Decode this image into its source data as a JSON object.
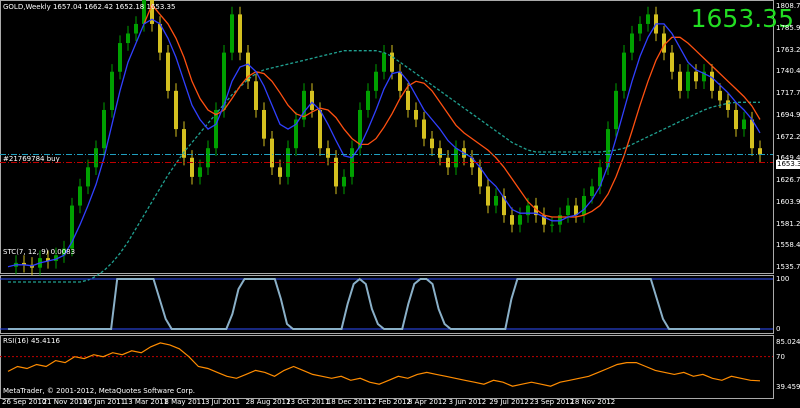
{
  "header": {
    "title": "GOLD,Weekly  1657.04 1662.42 1652.18 1653.35",
    "big_price": "1653.35",
    "order_label": "#21769784 buy",
    "order_price": "1653.35",
    "copyright": "MetaTrader, © 2001-2012, MetaQuotes Software Corp."
  },
  "stc": {
    "label": "STC(7, 12, 9) 0.0083",
    "levels": [
      "100",
      "0"
    ]
  },
  "rsi": {
    "label": "RSI(16) 45.4116",
    "levels": [
      "85.0241",
      "70",
      "39.4598"
    ]
  },
  "price_axis": [
    "1808.77",
    "1785.96",
    "1763.21",
    "1740.46",
    "1717.71",
    "1694.96",
    "1672.21",
    "1649.46",
    "1626.71",
    "1603.96",
    "1581.21",
    "1558.46",
    "1535.71"
  ],
  "time_axis": [
    "26 Sep 2010",
    "21 Nov 2010",
    "16 Jan 2011",
    "13 Mar 2011",
    "8 May 2011",
    "3 Jul 2011",
    "28 Aug 2011",
    "23 Oct 2011",
    "18 Dec 2011",
    "12 Feb 2012",
    "8 Apr 2012",
    "3 Jun 2012",
    "29 Jul 2012",
    "23 Sep 2012",
    "18 Nov 2012"
  ],
  "colors": {
    "background": "#000000",
    "bull_candle": "#00a000",
    "bear_candle": "#d4c020",
    "fast_ma": "#3040ff",
    "slow_ma": "#ff5010",
    "dotted_ma": "#20a090",
    "stc_line": "#8ab0c8",
    "rsi_line": "#ff8c00",
    "big_price": "#22dd22",
    "order_line": "#20a0c0",
    "stop_line": "#c00000"
  },
  "chart_data": [
    {
      "type": "candlestick",
      "title": "GOLD,Weekly",
      "ylim": [
        1535.71,
        1808.77
      ],
      "x_ticks": [
        "26 Sep 2010",
        "21 Nov 2010",
        "16 Jan 2011",
        "13 Mar 2011",
        "8 May 2011",
        "3 Jul 2011",
        "28 Aug 2011",
        "23 Oct 2011",
        "18 Dec 2011",
        "12 Feb 2012",
        "8 Apr 2012",
        "3 Jun 2012",
        "29 Jul 2012",
        "23 Sep 2012",
        "18 Nov 2012"
      ],
      "y_ticks": [
        1808.77,
        1785.96,
        1763.21,
        1740.46,
        1717.71,
        1694.96,
        1672.21,
        1649.46,
        1626.71,
        1603.96,
        1581.21,
        1558.46,
        1535.71
      ],
      "close_series": [
        1536,
        1540,
        1538,
        1535,
        1545,
        1542,
        1548,
        1555,
        1600,
        1620,
        1640,
        1660,
        1700,
        1740,
        1770,
        1780,
        1790,
        1820,
        1790,
        1760,
        1720,
        1680,
        1650,
        1630,
        1640,
        1660,
        1700,
        1760,
        1800,
        1760,
        1730,
        1700,
        1670,
        1640,
        1630,
        1660,
        1690,
        1720,
        1700,
        1660,
        1650,
        1620,
        1630,
        1660,
        1700,
        1720,
        1740,
        1760,
        1740,
        1720,
        1700,
        1690,
        1670,
        1660,
        1650,
        1640,
        1660,
        1650,
        1640,
        1620,
        1600,
        1610,
        1590,
        1580,
        1590,
        1600,
        1590,
        1580,
        1580,
        1590,
        1600,
        1590,
        1610,
        1620,
        1640,
        1680,
        1720,
        1760,
        1780,
        1790,
        1800,
        1780,
        1760,
        1740,
        1720,
        1740,
        1730,
        1740,
        1720,
        1710,
        1700,
        1680,
        1690,
        1660,
        1653.35
      ],
      "fast_ma_series": [
        1536,
        1538,
        1538,
        1537,
        1540,
        1542,
        1544,
        1548,
        1562,
        1580,
        1600,
        1622,
        1650,
        1685,
        1720,
        1750,
        1770,
        1790,
        1795,
        1790,
        1775,
        1755,
        1730,
        1705,
        1690,
        1680,
        1685,
        1705,
        1730,
        1745,
        1748,
        1740,
        1725,
        1705,
        1685,
        1680,
        1685,
        1698,
        1708,
        1700,
        1685,
        1668,
        1652,
        1650,
        1662,
        1680,
        1700,
        1722,
        1738,
        1740,
        1730,
        1715,
        1700,
        1690,
        1680,
        1668,
        1660,
        1655,
        1650,
        1640,
        1628,
        1620,
        1608,
        1596,
        1592,
        1592,
        1592,
        1588,
        1584,
        1584,
        1588,
        1590,
        1596,
        1606,
        1620,
        1642,
        1670,
        1700,
        1730,
        1756,
        1776,
        1790,
        1790,
        1780,
        1765,
        1750,
        1742,
        1738,
        1734,
        1726,
        1718,
        1708,
        1700,
        1690,
        1676
      ],
      "slow_ma_series": [
        null,
        null,
        null,
        null,
        null,
        null,
        null,
        null,
        null,
        null,
        null,
        null,
        null,
        null,
        null,
        null,
        null,
        1790,
        1810,
        1800,
        1790,
        1775,
        1755,
        1730,
        1712,
        1700,
        1695,
        1700,
        1712,
        1725,
        1735,
        1740,
        1738,
        1730,
        1718,
        1705,
        1696,
        1693,
        1698,
        1702,
        1700,
        1692,
        1680,
        1670,
        1664,
        1664,
        1670,
        1682,
        1696,
        1712,
        1725,
        1730,
        1728,
        1720,
        1708,
        1696,
        1684,
        1676,
        1670,
        1664,
        1658,
        1650,
        1640,
        1628,
        1616,
        1604,
        1596,
        1590,
        1588,
        1588,
        1588,
        1588,
        1590,
        1594,
        1600,
        1612,
        1630,
        1652,
        1678,
        1705,
        1730,
        1752,
        1768,
        1776,
        1776,
        1770,
        1762,
        1754,
        1746,
        1738,
        1730,
        1722,
        1714,
        1704,
        1690
      ],
      "dotted_ma_series": [
        1520,
        1520,
        1520,
        1520,
        1520,
        1520,
        1520,
        1520,
        1520,
        1520,
        1522,
        1526,
        1532,
        1540,
        1550,
        1562,
        1576,
        1590,
        1604,
        1618,
        1632,
        1644,
        1656,
        1666,
        1676,
        1686,
        1696,
        1706,
        1716,
        1724,
        1732,
        1738,
        1742,
        1744,
        1746,
        1748,
        1750,
        1752,
        1754,
        1756,
        1758,
        1760,
        1762,
        1762,
        1762,
        1762,
        1762,
        1760,
        1756,
        1750,
        1744,
        1738,
        1732,
        1726,
        1720,
        1714,
        1708,
        1702,
        1696,
        1690,
        1684,
        1678,
        1672,
        1666,
        1662,
        1658,
        1656,
        1656,
        1656,
        1656,
        1656,
        1656,
        1656,
        1656,
        1656,
        1657,
        1658,
        1660,
        1664,
        1668,
        1672,
        1676,
        1680,
        1684,
        1688,
        1692,
        1696,
        1700,
        1703,
        1705,
        1707,
        1708,
        1708,
        1708,
        1708
      ]
    },
    {
      "type": "line",
      "title": "STC(7, 12, 9)",
      "ylim": [
        0,
        100
      ],
      "y_ticks": [
        100,
        0
      ],
      "values": [
        0,
        0,
        0,
        0,
        0,
        0,
        0,
        0,
        0,
        0,
        0,
        0,
        0,
        0,
        0,
        0,
        0,
        0,
        100,
        100,
        100,
        100,
        100,
        100,
        100,
        60,
        20,
        0,
        0,
        0,
        0,
        0,
        0,
        0,
        0,
        0,
        0,
        30,
        80,
        100,
        100,
        100,
        100,
        100,
        100,
        60,
        10,
        0,
        0,
        0,
        0,
        0,
        0,
        0,
        0,
        0,
        50,
        90,
        100,
        90,
        40,
        10,
        0,
        0,
        0,
        0,
        50,
        90,
        100,
        100,
        90,
        40,
        10,
        0,
        0,
        0,
        0,
        0,
        0,
        0,
        0,
        0,
        0,
        60,
        100,
        100,
        100,
        100,
        100,
        100,
        100,
        100,
        100,
        100,
        100,
        100,
        100,
        100,
        100,
        100,
        100,
        100,
        100,
        100,
        100,
        100,
        100,
        60,
        20,
        0,
        0,
        0,
        0,
        0,
        0,
        0,
        0,
        0,
        0,
        0,
        0,
        0,
        0,
        0,
        0.0083
      ]
    },
    {
      "type": "line",
      "title": "RSI(16)",
      "ylim": [
        30,
        90
      ],
      "y_ticks": [
        85.0241,
        70,
        39.4598
      ],
      "values": [
        55,
        60,
        58,
        62,
        60,
        66,
        64,
        70,
        68,
        72,
        70,
        74,
        72,
        76,
        74,
        80,
        84,
        82,
        78,
        70,
        60,
        58,
        54,
        50,
        48,
        52,
        56,
        54,
        50,
        56,
        60,
        56,
        52,
        50,
        48,
        50,
        46,
        48,
        44,
        42,
        46,
        50,
        48,
        52,
        54,
        52,
        50,
        48,
        46,
        44,
        42,
        46,
        44,
        40,
        42,
        44,
        42,
        40,
        44,
        46,
        48,
        50,
        54,
        58,
        62,
        64,
        64,
        60,
        56,
        54,
        52,
        54,
        50,
        52,
        48,
        46,
        50,
        48,
        46,
        45.41
      ]
    }
  ]
}
